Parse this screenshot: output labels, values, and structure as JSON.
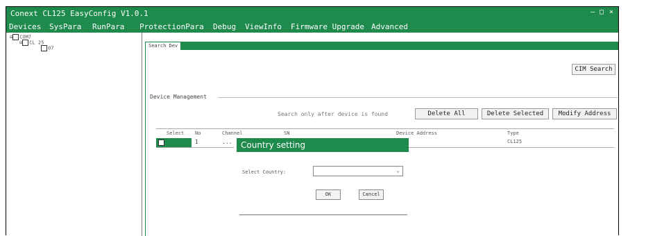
{
  "window": {
    "title": "Conext CL125 EasyConfig V1.0.1",
    "minimize": "–",
    "maximize": "□",
    "close": "×"
  },
  "menu": [
    "Devices",
    "SysPara",
    "RunPara",
    "ProtectionPara",
    "Debug",
    "ViewInfo",
    "Firmware Upgrade",
    "Advanced"
  ],
  "tree": {
    "root": "COM7",
    "child": "CL 25",
    "leaf": "07"
  },
  "tabs": [
    "Search Dev"
  ],
  "search_button": "CIM Search",
  "device_management": {
    "label": "Device Management",
    "hint": "Search only after device is found",
    "buttons": [
      "Delete All",
      "Delete Selected",
      "Modify Address"
    ]
  },
  "table": {
    "columns": [
      "Select",
      "No",
      "Channel",
      "SN",
      "Device Address",
      "Type"
    ],
    "rows": [
      {
        "no": "1",
        "channel": "...",
        "type": "CL125"
      }
    ]
  },
  "dialog": {
    "title": "Country setting",
    "label": "Select Country:",
    "select_value": "",
    "ok": "OK",
    "cancel": "Cancel"
  },
  "colors": {
    "brand_green": "#1e8a4c"
  }
}
